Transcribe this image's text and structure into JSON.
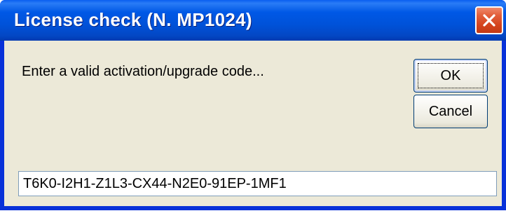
{
  "window": {
    "title": "License check (N. MP1024)"
  },
  "dialog": {
    "prompt": "Enter a valid activation/upgrade code...",
    "ok_label": "OK",
    "cancel_label": "Cancel",
    "code_value": "T6K0-I2H1-Z1L3-CX44-N2E0-91EP-1MF1"
  },
  "icons": {
    "close": "close-icon"
  },
  "colors": {
    "titlebar": "#0058e6",
    "client": "#ece9d8",
    "close_button": "#d4431c",
    "button_border": "#003c74"
  }
}
